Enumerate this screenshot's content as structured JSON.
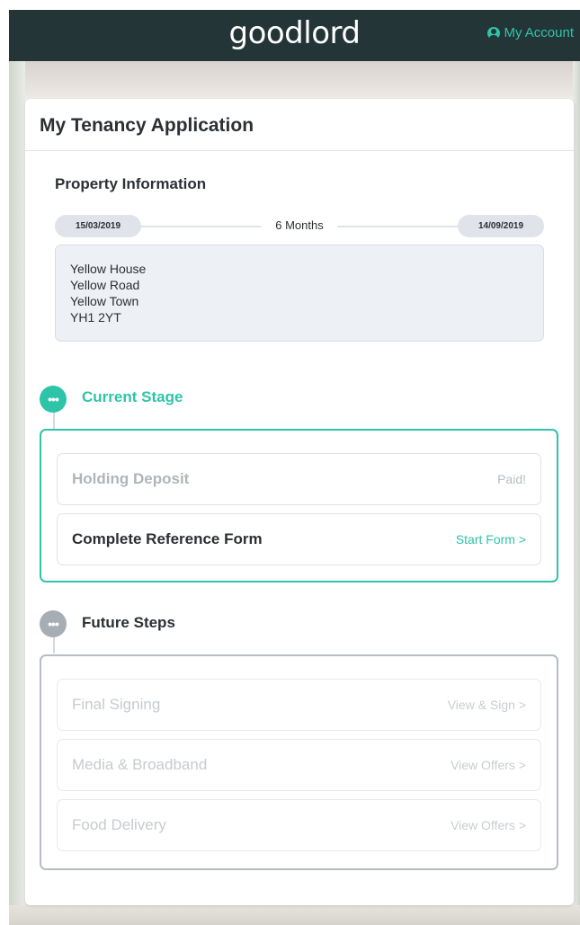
{
  "header": {
    "logo": "goodlord",
    "account_label": "My Account"
  },
  "card": {
    "title": "My Tenancy Application"
  },
  "property": {
    "heading": "Property Information",
    "start_date": "15/03/2019",
    "duration": "6 Months",
    "end_date": "14/09/2019",
    "address_lines": [
      "Yellow House",
      "Yellow Road",
      "Yellow Town",
      "YH1 2YT"
    ]
  },
  "current_stage": {
    "label": "Current Stage",
    "icon": "ellipsis-icon",
    "items": [
      {
        "name": "Holding Deposit",
        "action": "Paid!"
      },
      {
        "name": "Complete Reference Form",
        "action": "Start Form >"
      }
    ]
  },
  "future_steps": {
    "label": "Future Steps",
    "icon": "ellipsis-icon",
    "items": [
      {
        "name": "Final Signing",
        "action": "View & Sign >"
      },
      {
        "name": "Media & Broadband",
        "action": "View Offers >"
      },
      {
        "name": "Food Delivery",
        "action": "View Offers >"
      }
    ]
  },
  "colors": {
    "brand_dark": "#243538",
    "accent": "#2ec4a8",
    "muted": "#a7adb4"
  }
}
